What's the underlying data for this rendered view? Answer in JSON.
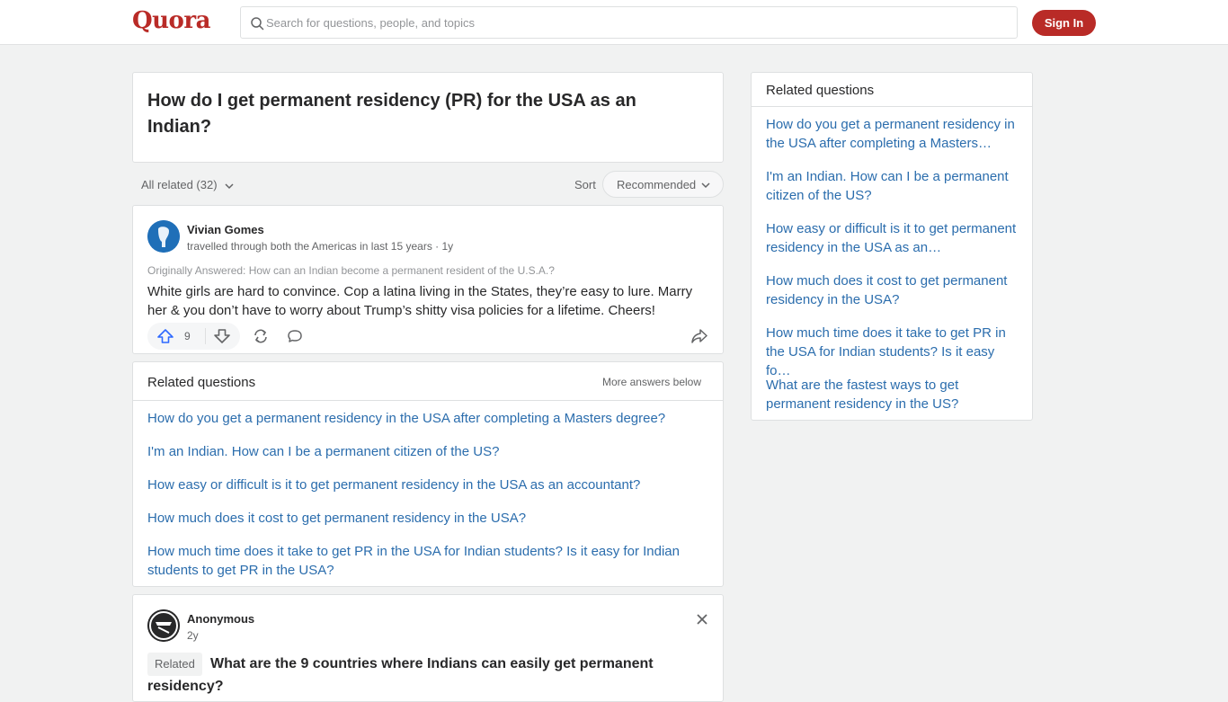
{
  "header": {
    "logo": "Quora",
    "search_placeholder": "Search for questions, people, and topics",
    "signin_label": "Sign In"
  },
  "question": {
    "title": "How do I get permanent residency (PR) for the USA as an Indian?"
  },
  "filters": {
    "all_related": "All related (32)",
    "sort_label": "Sort",
    "sort_value": "Recommended"
  },
  "answer": {
    "author": "Vivian Gomes",
    "credential": "travelled through both the Americas in last 15 years · 1y",
    "originally_answered": "Originally Answered: How can an Indian become a permanent resident of the U.S.A.?",
    "text": "White girls are hard to convince. Cop a latina living in the States, they’re easy to lure. Marry her & you don’t have to worry about Trump’s shitty visa policies for a lifetime. Cheers!",
    "upvotes": "9"
  },
  "related_main": {
    "title": "Related questions",
    "more_answers": "More answers below",
    "items": [
      "How do you get a permanent residency in the USA after completing a Masters degree?",
      "I'm an Indian. How can I be a permanent citizen of the US?",
      "How easy or difficult is it to get permanent residency in the USA as an accountant?",
      "How much does it cost to get permanent residency in the USA?",
      "How much time does it take to get PR in the USA for Indian students? Is it easy for Indian students to get PR in the USA?"
    ]
  },
  "anon_answer": {
    "author": "Anonymous",
    "time": "2y",
    "badge": "Related",
    "question": "What are the 9 countries where Indians can easily get permanent residency?"
  },
  "sidebar": {
    "title": "Related questions",
    "items": [
      "How do you get a permanent residency in the USA after completing a Masters…",
      "I'm an Indian. How can I be a permanent citizen of the US?",
      "How easy or difficult is it to get permanent residency in the USA as an…",
      "How much does it cost to get permanent residency in the USA?",
      "How much time does it take to get PR in the USA for Indian students? Is it easy fo…",
      "What are the fastest ways to get permanent residency in the US?"
    ]
  },
  "colors": {
    "brand": "#b92b27",
    "link": "#2b6dad",
    "background": "#f1f2f2"
  }
}
